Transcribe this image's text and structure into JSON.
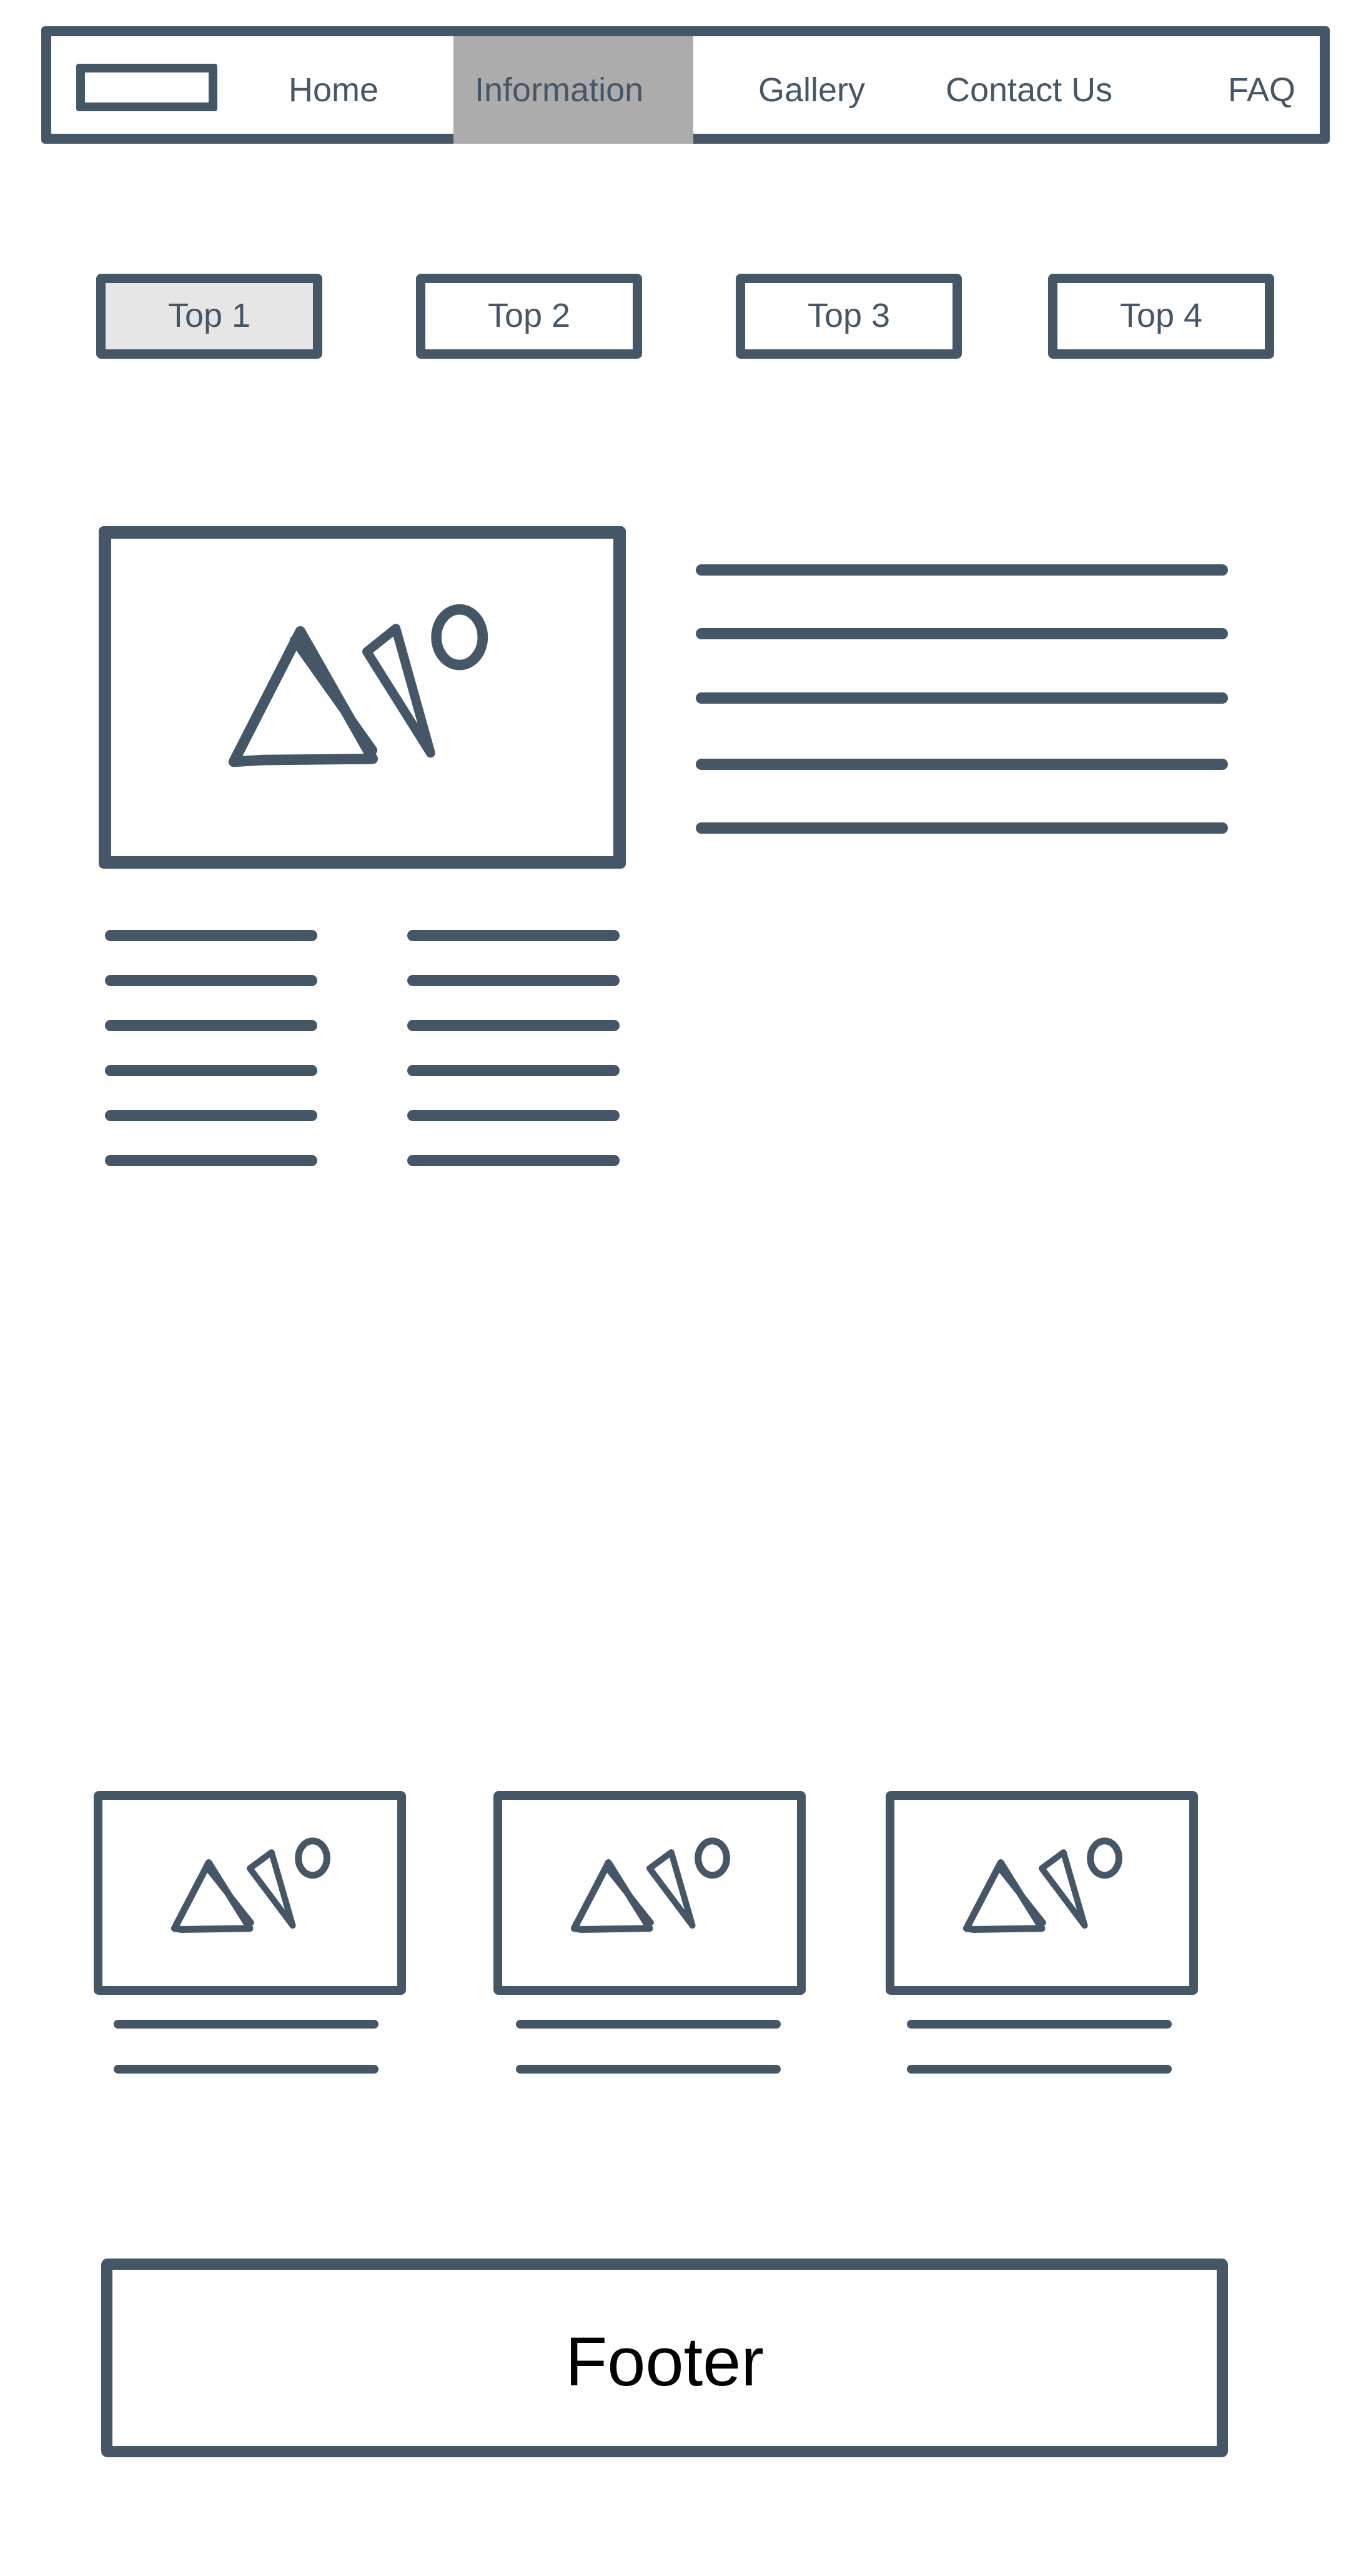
{
  "nav": {
    "logo_icon": "logo-placeholder",
    "links": [
      "Home",
      "Information",
      "Gallery",
      "Contact Us",
      "FAQ"
    ],
    "active": "Information"
  },
  "top_buttons": [
    "Top 1",
    "Top 2",
    "Top 3",
    "Top 4"
  ],
  "footer": {
    "label": "Footer"
  },
  "icons": {
    "image": "image-placeholder-icon"
  },
  "colors": {
    "stroke": "#455666",
    "nav_active_bg": "#acacac",
    "button_active_bg": "#e6e6e6",
    "footer_text": "#000000"
  }
}
